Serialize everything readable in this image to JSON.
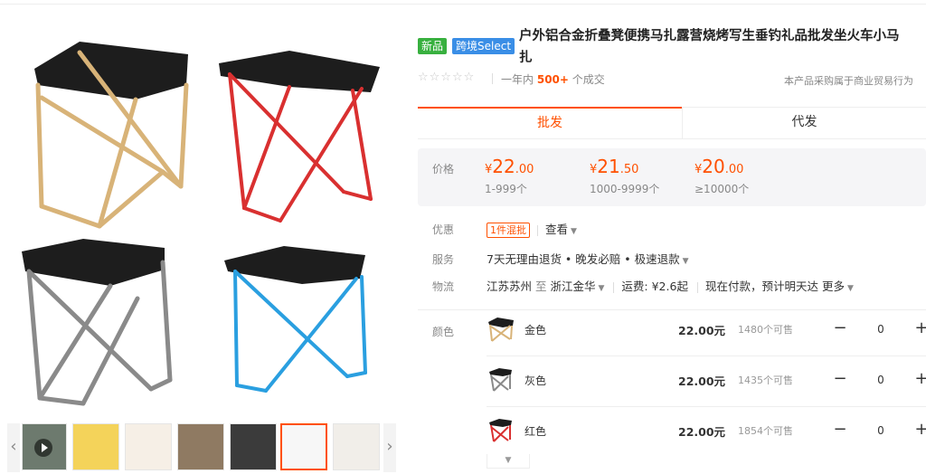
{
  "product": {
    "badges": {
      "new": "新品",
      "cross_border": "跨境Select"
    },
    "title_line1": "户外铝合金折叠凳便携马扎露营烧烤写生垂钓礼品批发坐火车小马",
    "title_line2": "扎",
    "rating_stars": "☆☆☆☆☆",
    "sales_prefix": "一年内",
    "sales_count": "500+",
    "sales_suffix": "个成交",
    "notice": "本产品采购属于商业贸易行为"
  },
  "tabs": [
    {
      "label": "批发",
      "active": true
    },
    {
      "label": "代发",
      "active": false
    }
  ],
  "price": {
    "label": "价格",
    "tiers": [
      {
        "currency": "¥",
        "int": "22",
        "dec": ".00",
        "range": "1-999个"
      },
      {
        "currency": "¥",
        "int": "21",
        "dec": ".50",
        "range": "1000-9999个"
      },
      {
        "currency": "¥",
        "int": "20",
        "dec": ".00",
        "range": "≥10000个"
      }
    ]
  },
  "promo": {
    "label": "优惠",
    "tag": "1件混批",
    "view": "查看"
  },
  "service": {
    "label": "服务",
    "text": "7天无理由退货 • 晚发必赔 • 极速退款"
  },
  "logistics": {
    "label": "物流",
    "from": "江苏苏州",
    "to_word": "至",
    "to": "浙江金华",
    "freight": "运费: ¥2.6起",
    "delivery": "现在付款，预计明天达",
    "more": "更多"
  },
  "colors": {
    "label": "颜色",
    "items": [
      {
        "name": "金色",
        "price": "22.00元",
        "stock": "1480个可售",
        "qty": "0",
        "frame": "#d8b378"
      },
      {
        "name": "灰色",
        "price": "22.00元",
        "stock": "1435个可售",
        "qty": "0",
        "frame": "#8a8a8a"
      },
      {
        "name": "红色",
        "price": "22.00元",
        "stock": "1854个可售",
        "qty": "0",
        "frame": "#d93030"
      }
    ],
    "minus": "−",
    "plus": "+"
  },
  "accent": "#ff5000",
  "gallery": {
    "frames": [
      "#d8b378",
      "#d93030",
      "#8a8a8a",
      "#2a9fe0"
    ],
    "prev": "‹",
    "next": "›"
  }
}
